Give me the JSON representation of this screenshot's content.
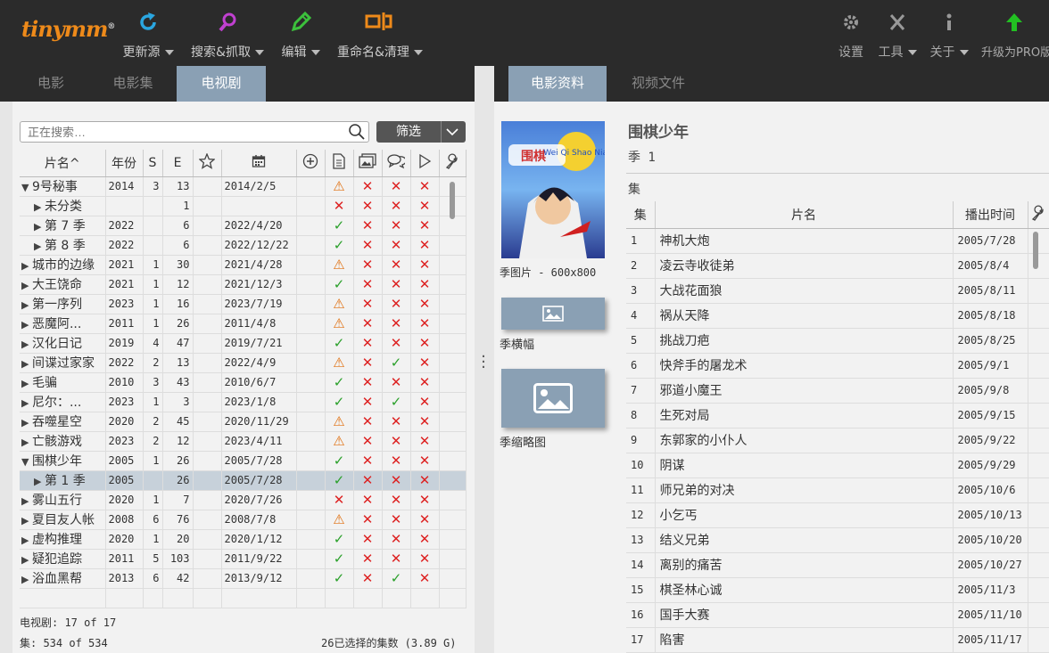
{
  "app": {
    "logo": "tinymm",
    "logo_mark": "®"
  },
  "toolbar": {
    "update": "更新源",
    "search": "搜索&抓取",
    "edit": "编辑",
    "rename": "重命名&清理",
    "settings": "设置",
    "tools": "工具",
    "about": "关于",
    "upgrade": "升级为PRO版"
  },
  "colors": {
    "accent": "#ee8a1a",
    "tab_active": "#8aa0b4",
    "toolbar_bg": "#2b2b2b"
  },
  "left_tabs": [
    "电影",
    "电影集",
    "电视剧"
  ],
  "left_active_tab": "电视剧",
  "right_tabs": [
    "电影资料",
    "视频文件"
  ],
  "right_active_tab": "电影资料",
  "search": {
    "placeholder": "正在搜索…"
  },
  "filter": {
    "label": "筛选"
  },
  "table": {
    "columns": [
      "片名",
      "年份",
      "S",
      "E",
      "star-icon",
      "calendar-icon",
      "add-icon",
      "document-icon",
      "images-icon",
      "chat-icon",
      "play-icon",
      "wrench-icon"
    ],
    "rows": [
      {
        "level": 0,
        "exp": "open",
        "name": "9号秘事",
        "year": "2014",
        "s": "3",
        "e": "13",
        "date": "2014/2/5",
        "nfo": "warn",
        "img": "no",
        "sub": "no",
        "play": "no"
      },
      {
        "level": 1,
        "exp": "closed",
        "name": "未分类",
        "year": "",
        "s": "",
        "e": "1",
        "date": "",
        "nfo": "no",
        "img": "no",
        "sub": "no",
        "play": "no"
      },
      {
        "level": 1,
        "exp": "closed",
        "name": "第 7 季",
        "year": "2022",
        "s": "",
        "e": "6",
        "date": "2022/4/20",
        "nfo": "ok",
        "img": "no",
        "sub": "no",
        "play": "no"
      },
      {
        "level": 1,
        "exp": "closed",
        "name": "第 8 季",
        "year": "2022",
        "s": "",
        "e": "6",
        "date": "2022/12/22",
        "nfo": "ok",
        "img": "no",
        "sub": "no",
        "play": "no"
      },
      {
        "level": 0,
        "exp": "closed",
        "name": "城市的边缘",
        "year": "2021",
        "s": "1",
        "e": "30",
        "date": "2021/4/28",
        "nfo": "warn",
        "img": "no",
        "sub": "no",
        "play": "no"
      },
      {
        "level": 0,
        "exp": "closed",
        "name": "大王饶命",
        "year": "2021",
        "s": "1",
        "e": "12",
        "date": "2021/12/3",
        "nfo": "ok",
        "img": "no",
        "sub": "no",
        "play": "no"
      },
      {
        "level": 0,
        "exp": "closed",
        "name": "第一序列",
        "year": "2023",
        "s": "1",
        "e": "16",
        "date": "2023/7/19",
        "nfo": "warn",
        "img": "no",
        "sub": "no",
        "play": "no"
      },
      {
        "level": 0,
        "exp": "closed",
        "name": "恶魔阿...",
        "year": "2011",
        "s": "1",
        "e": "26",
        "date": "2011/4/8",
        "nfo": "warn",
        "img": "no",
        "sub": "no",
        "play": "no"
      },
      {
        "level": 0,
        "exp": "closed",
        "name": "汉化日记",
        "year": "2019",
        "s": "4",
        "e": "47",
        "date": "2019/7/21",
        "nfo": "ok",
        "img": "no",
        "sub": "no",
        "play": "no"
      },
      {
        "level": 0,
        "exp": "closed",
        "name": "间谍过家家",
        "year": "2022",
        "s": "2",
        "e": "13",
        "date": "2022/4/9",
        "nfo": "warn",
        "img": "no",
        "sub": "ok",
        "play": "no"
      },
      {
        "level": 0,
        "exp": "closed",
        "name": "毛骗",
        "year": "2010",
        "s": "3",
        "e": "43",
        "date": "2010/6/7",
        "nfo": "ok",
        "img": "no",
        "sub": "no",
        "play": "no"
      },
      {
        "level": 0,
        "exp": "closed",
        "name": "尼尔：...",
        "year": "2023",
        "s": "1",
        "e": "3",
        "date": "2023/1/8",
        "nfo": "ok",
        "img": "no",
        "sub": "ok",
        "play": "no"
      },
      {
        "level": 0,
        "exp": "closed",
        "name": "吞噬星空",
        "year": "2020",
        "s": "2",
        "e": "45",
        "date": "2020/11/29",
        "nfo": "warn",
        "img": "no",
        "sub": "no",
        "play": "no"
      },
      {
        "level": 0,
        "exp": "closed",
        "name": "亡骸游戏",
        "year": "2023",
        "s": "2",
        "e": "12",
        "date": "2023/4/11",
        "nfo": "warn",
        "img": "no",
        "sub": "no",
        "play": "no"
      },
      {
        "level": 0,
        "exp": "open",
        "name": "围棋少年",
        "year": "2005",
        "s": "1",
        "e": "26",
        "date": "2005/7/28",
        "nfo": "ok",
        "img": "no",
        "sub": "no",
        "play": "no"
      },
      {
        "level": 1,
        "exp": "closed",
        "name": "第 1 季",
        "year": "2005",
        "s": "",
        "e": "26",
        "date": "2005/7/28",
        "nfo": "ok",
        "img": "no",
        "sub": "no",
        "play": "no",
        "selected": true
      },
      {
        "level": 0,
        "exp": "closed",
        "name": "雾山五行",
        "year": "2020",
        "s": "1",
        "e": "7",
        "date": "2020/7/26",
        "nfo": "no",
        "img": "no",
        "sub": "no",
        "play": "no"
      },
      {
        "level": 0,
        "exp": "closed",
        "name": "夏目友人帐",
        "year": "2008",
        "s": "6",
        "e": "76",
        "date": "2008/7/8",
        "nfo": "warn",
        "img": "no",
        "sub": "no",
        "play": "no"
      },
      {
        "level": 0,
        "exp": "closed",
        "name": "虚构推理",
        "year": "2020",
        "s": "1",
        "e": "20",
        "date": "2020/1/12",
        "nfo": "ok",
        "img": "no",
        "sub": "no",
        "play": "no"
      },
      {
        "level": 0,
        "exp": "closed",
        "name": "疑犯追踪",
        "year": "2011",
        "s": "5",
        "e": "103",
        "date": "2011/9/22",
        "nfo": "ok",
        "img": "no",
        "sub": "no",
        "play": "no"
      },
      {
        "level": 0,
        "exp": "closed",
        "name": "浴血黑帮",
        "year": "2013",
        "s": "6",
        "e": "42",
        "date": "2013/9/12",
        "nfo": "ok",
        "img": "no",
        "sub": "ok",
        "play": "no"
      }
    ]
  },
  "status": {
    "shows": "电视剧: 17 of 17",
    "episodes": "集: 534 of 534",
    "selected": "26已选择的集数 (3.89 G)"
  },
  "detail": {
    "title": "围棋少年",
    "season": "季 1",
    "poster_caption": "季图片 - 600x800",
    "poster_text": "Wei Qi Shao Nian",
    "banner_caption": "季横幅",
    "thumb_caption": "季缩略图",
    "episodes_label": "集",
    "columns": [
      "集",
      "片名",
      "播出时间",
      "wrench-icon"
    ],
    "episodes": [
      {
        "no": "1",
        "title": "神机大炮",
        "aired": "2005/7/28"
      },
      {
        "no": "2",
        "title": "凌云寺收徒弟",
        "aired": "2005/8/4"
      },
      {
        "no": "3",
        "title": "大战花面狼",
        "aired": "2005/8/11"
      },
      {
        "no": "4",
        "title": "祸从天降",
        "aired": "2005/8/18"
      },
      {
        "no": "5",
        "title": "挑战刀疤",
        "aired": "2005/8/25"
      },
      {
        "no": "6",
        "title": "快斧手的屠龙术",
        "aired": "2005/9/1"
      },
      {
        "no": "7",
        "title": "邪道小魔王",
        "aired": "2005/9/8"
      },
      {
        "no": "8",
        "title": "生死对局",
        "aired": "2005/9/15"
      },
      {
        "no": "9",
        "title": "东郭家的小仆人",
        "aired": "2005/9/22"
      },
      {
        "no": "10",
        "title": "阴谋",
        "aired": "2005/9/29"
      },
      {
        "no": "11",
        "title": "师兄弟的对决",
        "aired": "2005/10/6"
      },
      {
        "no": "12",
        "title": "小乞丐",
        "aired": "2005/10/13"
      },
      {
        "no": "13",
        "title": "结义兄弟",
        "aired": "2005/10/20"
      },
      {
        "no": "14",
        "title": "离别的痛苦",
        "aired": "2005/10/27"
      },
      {
        "no": "15",
        "title": "棋圣林心诚",
        "aired": "2005/11/3"
      },
      {
        "no": "16",
        "title": "国手大赛",
        "aired": "2005/11/10"
      },
      {
        "no": "17",
        "title": "陷害",
        "aired": "2005/11/17"
      }
    ]
  }
}
